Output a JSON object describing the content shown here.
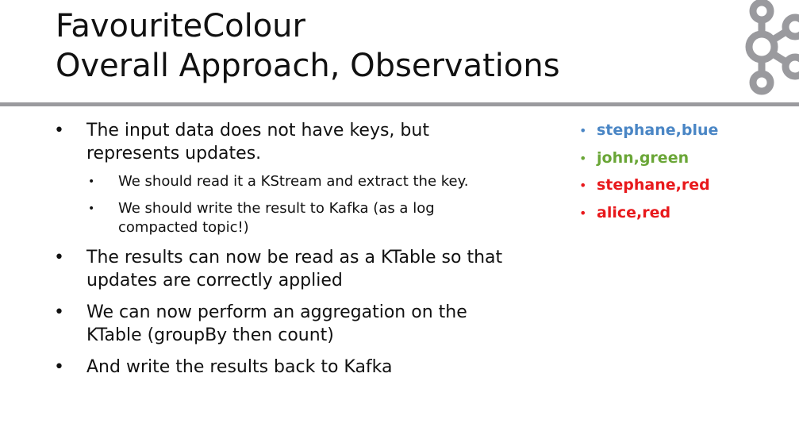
{
  "title": {
    "line1": "FavouriteColour",
    "line2": "Overall Approach, Observations"
  },
  "logo": {
    "icon": "kafka-logo-icon",
    "color": "#9a9a9e"
  },
  "bullets": [
    {
      "text": "The input data does not have keys, but represents updates.",
      "sub": [
        "We should read it a KStream and extract the key.",
        "We should write the result to Kafka (as a log compacted topic!)"
      ]
    },
    {
      "text": "The results can now be read as a KTable so that updates are correctly applied",
      "sub": []
    },
    {
      "text": "We can now perform an aggregation on the KTable (groupBy then count)",
      "sub": []
    },
    {
      "text": "And write the results back to Kafka",
      "sub": []
    }
  ],
  "bullet_glyph": "•",
  "sub_bullet_glyph": "•",
  "examples": [
    {
      "text": "stephane,blue",
      "color": "#4a86c5"
    },
    {
      "text": "john,green",
      "color": "#6aa637"
    },
    {
      "text": "stephane,red",
      "color": "#e8191c"
    },
    {
      "text": "alice,red",
      "color": "#e8191c"
    }
  ]
}
